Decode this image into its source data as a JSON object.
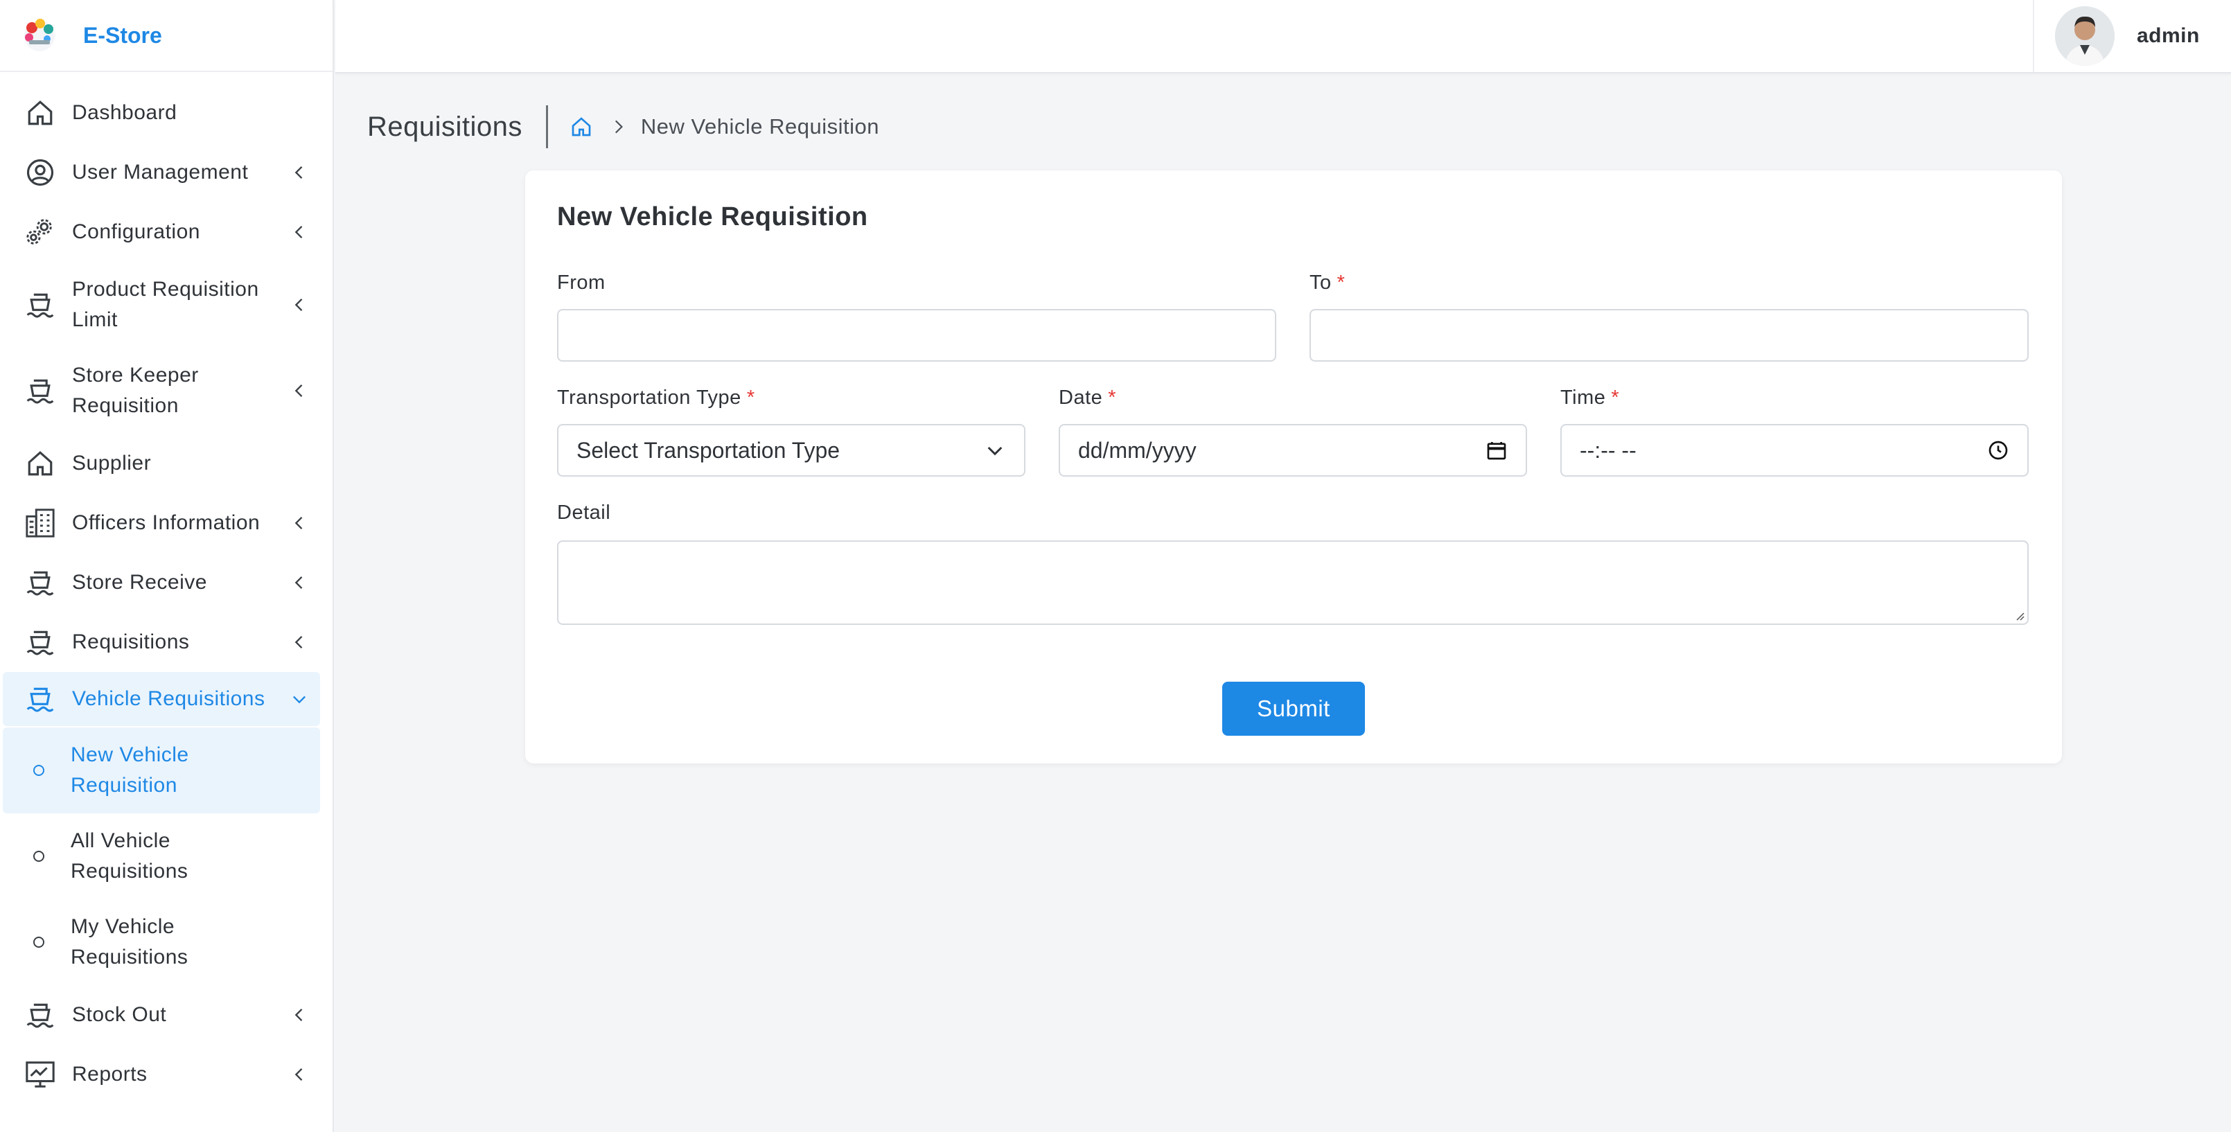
{
  "app": {
    "name": "E-Store"
  },
  "sidebar": {
    "items": [
      {
        "label": "Dashboard",
        "icon": "home-icon",
        "has_children": false
      },
      {
        "label": "User Management",
        "icon": "user-circle-icon",
        "has_children": true
      },
      {
        "label": "Configuration",
        "icon": "gears-icon",
        "has_children": true
      },
      {
        "label": "Product Requisition Limit",
        "icon": "ship-icon",
        "has_children": true
      },
      {
        "label": "Store Keeper Requisition",
        "icon": "ship-icon",
        "has_children": true
      },
      {
        "label": "Supplier",
        "icon": "home-icon",
        "has_children": false
      },
      {
        "label": "Officers Information",
        "icon": "building-icon",
        "has_children": true
      },
      {
        "label": "Store Receive",
        "icon": "ship-icon",
        "has_children": true
      },
      {
        "label": "Requisitions",
        "icon": "ship-icon",
        "has_children": true
      },
      {
        "label": "Vehicle Requisitions",
        "icon": "ship-icon",
        "has_children": true,
        "expanded": true,
        "children": [
          {
            "label": "New Vehicle Requisition",
            "active": true
          },
          {
            "label": "All Vehicle Requisitions",
            "active": false
          },
          {
            "label": "My Vehicle Requisitions",
            "active": false
          }
        ]
      },
      {
        "label": "Stock Out",
        "icon": "ship-icon",
        "has_children": true
      },
      {
        "label": "Reports",
        "icon": "monitor-chart-icon",
        "has_children": true
      }
    ]
  },
  "topbar": {
    "user_name": "admin"
  },
  "page": {
    "title": "Requisitions",
    "breadcrumb_current": "New Vehicle Requisition"
  },
  "form": {
    "title": "New Vehicle Requisition",
    "from_label": "From",
    "from_value": "",
    "to_label": "To",
    "to_value": "",
    "transport_label": "Transportation Type",
    "transport_selected": "Select Transportation Type",
    "date_label": "Date",
    "date_placeholder": "dd/mm/yyyy",
    "time_label": "Time",
    "time_placeholder": "--:-- --",
    "detail_label": "Detail",
    "detail_value": "",
    "required_mark": "*",
    "submit_label": "Submit"
  },
  "colors": {
    "accent": "#1e88e5",
    "required": "#e53935",
    "background": "#f4f5f7"
  }
}
